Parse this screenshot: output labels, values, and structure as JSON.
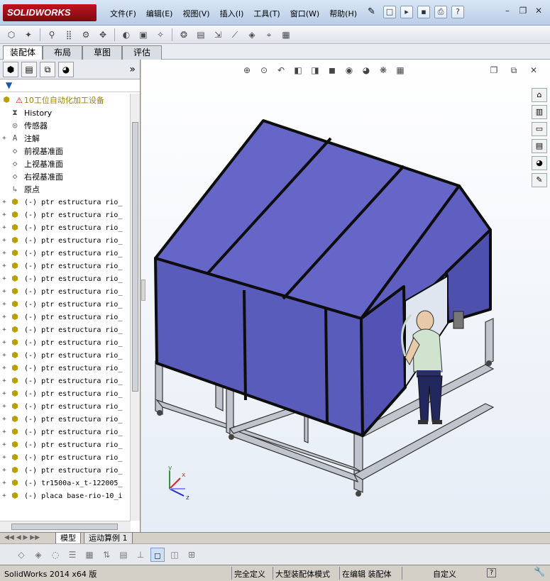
{
  "app": {
    "logo_text": "SOLIDWORKS"
  },
  "menu": [
    "文件(F)",
    "编辑(E)",
    "视图(V)",
    "插入(I)",
    "工具(T)",
    "窗口(W)",
    "帮助(H)"
  ],
  "command_tabs": [
    "装配体",
    "布局",
    "草图",
    "评估"
  ],
  "feature_tree": {
    "root": "10工位自动化加工设备",
    "items": [
      {
        "label": "History",
        "icon": "history-icon",
        "expand": ""
      },
      {
        "label": "传感器",
        "icon": "sensor-icon",
        "expand": ""
      },
      {
        "label": "注解",
        "icon": "annotation-icon",
        "expand": "+"
      },
      {
        "label": "前视基准面",
        "icon": "plane-icon",
        "expand": ""
      },
      {
        "label": "上视基准面",
        "icon": "plane-icon",
        "expand": ""
      },
      {
        "label": "右视基准面",
        "icon": "plane-icon",
        "expand": ""
      },
      {
        "label": "原点",
        "icon": "origin-icon",
        "expand": ""
      }
    ],
    "parts": [
      "(-) ptr estructura rio_",
      "(-) ptr estructura rio_",
      "(-) ptr estructura rio_",
      "(-) ptr estructura rio_",
      "(-) ptr estructura rio_",
      "(-) ptr estructura rio_",
      "(-) ptr estructura rio_",
      "(-) ptr estructura rio_",
      "(-) ptr estructura rio_",
      "(-) ptr estructura rio_",
      "(-) ptr estructura rio_",
      "(-) ptr estructura rio_",
      "(-) ptr estructura rio_",
      "(-) ptr estructura rio_",
      "(-) ptr estructura rio_",
      "(-) ptr estructura rio_",
      "(-) ptr estructura rio_",
      "(-) ptr estructura rio_",
      "(-) ptr estructura rio_",
      "(-) ptr estructura rio_",
      "(-) ptr estructura rio_",
      "(-) ptr estructura rio_",
      "(-) tr1500a-x_t-122005_",
      "(-) placa base-rio-10_i"
    ]
  },
  "bottom_tabs": [
    "模型",
    "运动算例 1"
  ],
  "status": {
    "version": "SolidWorks 2014 x64 版",
    "fully_defined": "完全定义",
    "large_assembly": "大型装配体模式",
    "editing": "在编辑 装配体",
    "units": "自定义",
    "help": "?"
  },
  "triad": {
    "x": "x",
    "y": "y",
    "z": "z"
  },
  "colors": {
    "panel": "#5b5fc4",
    "frame": "#b8bcc6",
    "accent": "#c1121f"
  }
}
